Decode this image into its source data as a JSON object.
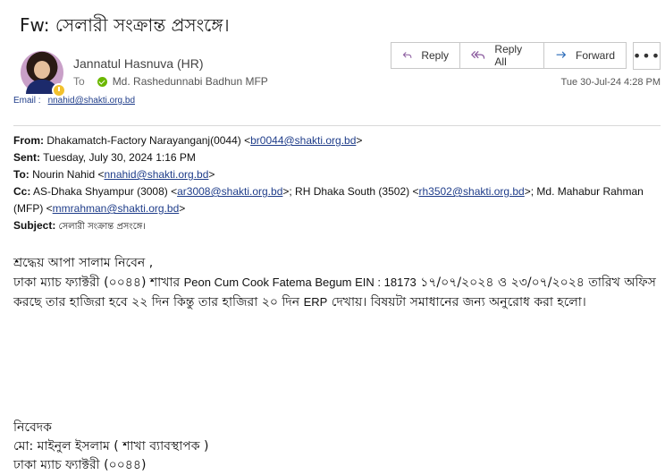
{
  "message": {
    "subject_title": "Fw: সেলারী সংক্রান্ত প্রসংঙ্গে।",
    "sender_name": "Jannatul Hasnuva (HR)",
    "to_label": "To",
    "to_name": "Md. Rashedunnabi Badhun MFP",
    "email_label": "Email :",
    "email_value": "nnahid@shakti.org.bd",
    "date": "Tue 30-Jul-24 4:28 PM"
  },
  "toolbar": {
    "reply": "Reply",
    "reply_all": "Reply All",
    "forward": "Forward",
    "more": "•••"
  },
  "forward_header": {
    "from_label": "From:",
    "from_name": " Dhakamatch-Factory Narayanganj(0044) <",
    "from_email": "br0044@shakti.org.bd",
    "from_end": ">",
    "sent_label": "Sent:",
    "sent_value": " Tuesday, July 30, 2024 1:16 PM",
    "to_label": "To:",
    "to_name": " Nourin Nahid <",
    "to_email": "nnahid@shakti.org.bd",
    "to_end": ">",
    "cc_label": "Cc:",
    "cc_1_name": " AS-Dhaka Shyampur (3008) <",
    "cc_1_email": "ar3008@shakti.org.bd",
    "cc_2_name": ">; RH Dhaka South (3502) <",
    "cc_2_email": "rh3502@shakti.org.bd",
    "cc_3_name": ">; Md. Mahabur Rahman (MFP) <",
    "cc_3_email": "mmrahman@shakti.org.bd",
    "cc_end": ">",
    "subject_label": "Subject:",
    "subject_value": " সেলারী সংক্রান্ত প্রসংঙ্গে।"
  },
  "body": {
    "greeting": "শ্রদ্ধেয় আপা সালাম নিবেন ,",
    "p1_a": "ঢাকা ম্যাচ ফ্যাক্টরী (০০৪৪) শাখার ",
    "p1_b": "Peon Cum Cook Fatema Begum  EIN : 18173",
    "p1_c": "  ১৭/০৭/২০২৪ ও ২৩/০৭/২০২৪ তারিখ অফিস করছে তার হাজিরা হবে ২২ দিন কিন্তু তার হাজিরা ২০ দিন  ",
    "p1_d": "ERP",
    "p1_e": "  দেখায়। বিষয়টা সমাধানের জন্য অনুরোধ করা হলো।"
  },
  "signature": {
    "line1": "নিবেদক",
    "line2": "মো: মাইনুল ইসলাম ( শাখা ব্যাবস্থাপক )",
    "line3": "ঢাকা ম্যাচ ফ্যাক্টরী (০০৪৪)"
  }
}
